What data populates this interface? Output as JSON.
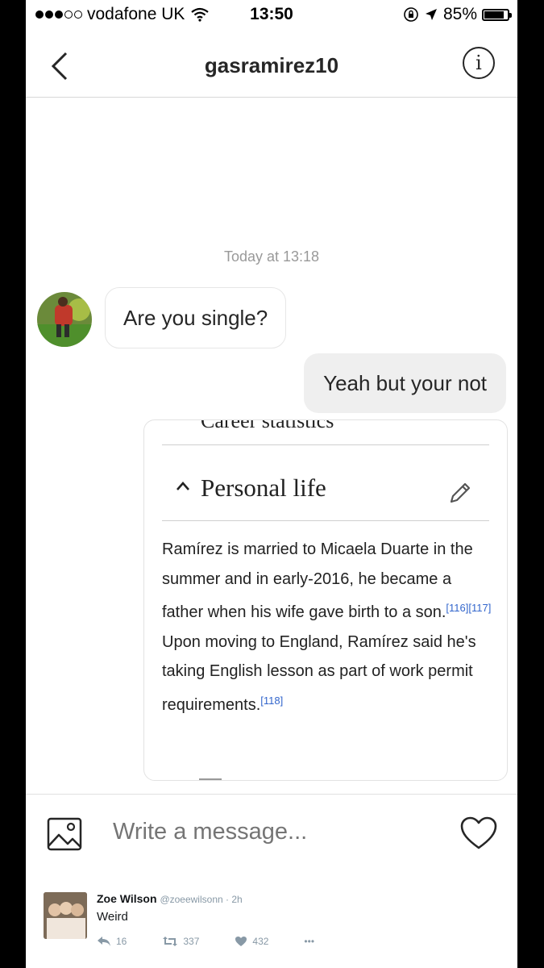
{
  "status_bar": {
    "carrier": "vodafone UK",
    "time": "13:50",
    "battery": "85%",
    "battery_level": 0.85
  },
  "header": {
    "title": "gasramirez10"
  },
  "conversation": {
    "timestamp": "Today at 13:18",
    "incoming_message": "Are you single?",
    "outgoing_message": "Yeah but your not"
  },
  "wiki_card": {
    "top_partial": "Career statistics",
    "section_title": "Personal life",
    "text_part1": "Ramírez is married to Micaela Duarte in the summer and in early-2016, he became a father when his wife gave birth to a son.",
    "ref1": "[116][117]",
    "text_part2": " Upon moving to England, Ramírez said he's taking English lesson as part of work permit requirements.",
    "ref2": "[118]"
  },
  "composer": {
    "placeholder": "Write a message..."
  },
  "tweet": {
    "name": "Zoe Wilson",
    "handle": "@zoeewilsonn · 2h",
    "text": "Weird",
    "replies": "16",
    "retweets": "337",
    "likes": "432",
    "more": "•••"
  }
}
